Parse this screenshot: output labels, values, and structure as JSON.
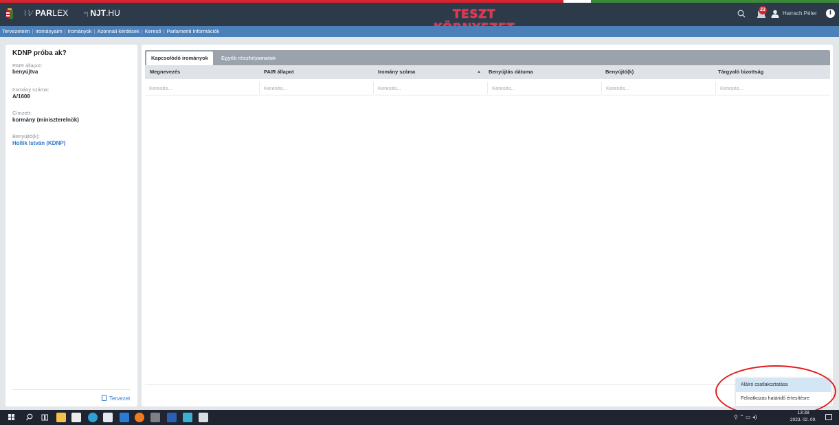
{
  "header": {
    "logo_parlex_a": "PAR",
    "logo_parlex_b": "LEX",
    "logo_njt_a": "NJT",
    "logo_njt_b": ".HU",
    "environment_title": "TESZT KÖRNYEZET",
    "notification_count": "23",
    "user_name": "Harrach Péter",
    "info_glyph": "i",
    "colors": {
      "topbar": "#2d3a4a",
      "env_title": "#e8324b",
      "navbar": "#4c80b8"
    }
  },
  "nav": {
    "items": [
      {
        "label": "Tervezeteim"
      },
      {
        "label": "Irományaim"
      },
      {
        "label": "Irományok"
      },
      {
        "label": "Azonnali kérdések"
      },
      {
        "label": "Kereső"
      },
      {
        "label": "Parlamenti Információk"
      }
    ],
    "separator": "|"
  },
  "left_panel": {
    "title": "KDNP próba ak?",
    "fields": [
      {
        "label": "PAIR állapot:",
        "value": "benyújtva"
      },
      {
        "label": "Iromány száma:",
        "value": "A/1608"
      },
      {
        "label": "Címzett:",
        "value": "kormány (miniszterelnök)"
      },
      {
        "label": "Benyújtó(k):",
        "value": "Hollik István (KDNP)"
      }
    ],
    "draft_button": "Tervezet"
  },
  "content": {
    "tabs": [
      {
        "label": "Kapcsolódó irományok",
        "active": true
      },
      {
        "label": "Egyéb részfolyamatok",
        "active": false
      }
    ],
    "columns": [
      {
        "label": "Megnevezés"
      },
      {
        "label": "PAIR állapot"
      },
      {
        "label": "Iromány száma"
      },
      {
        "label": "Benyújtás dátuma"
      },
      {
        "label": "Benyújtó(k)"
      },
      {
        "label": "Tárgyaló bizottság"
      }
    ],
    "sort_indicator": "▲",
    "filter_placeholder": "Keresés..."
  },
  "popup_menu": {
    "items": [
      {
        "label": "Aláíró csatlakoztatása",
        "highlighted": true
      },
      {
        "label": "Feliratkozás határidő értesítésre",
        "highlighted": false
      }
    ]
  },
  "taskbar": {
    "icons": [
      "windows-start-icon",
      "search-icon",
      "task-view-icon",
      "file-explorer-icon",
      "store-icon",
      "edge-icon",
      "mail-icon",
      "outlook-icon",
      "firefox-icon",
      "chrome-icon",
      "word-icon",
      "sway-icon",
      "app-icon"
    ],
    "clock_time": "13:38",
    "clock_date": "2023. 02. 09."
  }
}
